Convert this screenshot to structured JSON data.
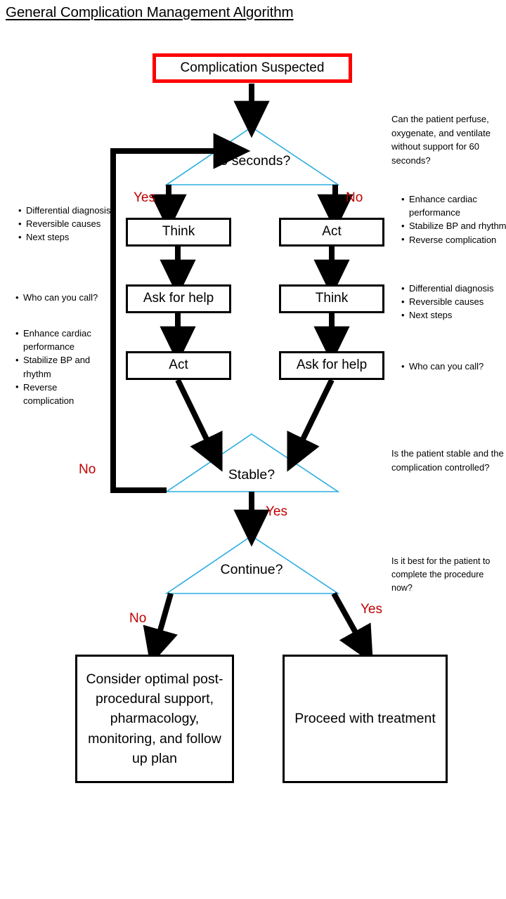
{
  "title": "General Complication Management Algorithm",
  "nodes": {
    "start": "Complication Suspected",
    "left_1": "Think",
    "left_2": "Ask for help",
    "left_3": "Act",
    "right_1": "Act",
    "right_2": "Think",
    "right_3": "Ask for help",
    "outcome_no": "Consider optimal post-procedural support, pharmacology, monitoring, and follow up plan",
    "outcome_yes": "Proceed with treatment"
  },
  "decisions": {
    "d1": "60 seconds?",
    "d2": "Stable?",
    "d3": "Continue?"
  },
  "edge_labels": {
    "d1_yes": "Yes",
    "d1_no": "No",
    "d2_no": "No",
    "d2_yes": "Yes",
    "d3_no": "No",
    "d3_yes": "Yes"
  },
  "annotations": {
    "d1_question": "Can the patient perfuse, oxygenate, and ventilate without support for 60 seconds?",
    "d2_question": "Is the patient stable and the complication controlled?",
    "d3_question": "Is it best for the patient to complete the procedure now?",
    "left_think_bullets": [
      "Differential diagnosis",
      "Reversible causes",
      "Next steps"
    ],
    "left_help_bullets": [
      "Who can you call?"
    ],
    "left_act_bullets": [
      "Enhance cardiac performance",
      "Stabilize BP and rhythm",
      "Reverse complication"
    ],
    "right_act_bullets": [
      "Enhance cardiac performance",
      "Stabilize BP and rhythm",
      "Reverse complication"
    ],
    "right_think_bullets": [
      "Differential diagnosis",
      "Reversible causes",
      "Next steps"
    ],
    "right_help_bullets": [
      "Who can you call?"
    ]
  },
  "colors": {
    "start_border": "#FF0000",
    "decision_outline": "#2BAEE0",
    "edge_label": "#C00000",
    "connector": "#000000"
  }
}
